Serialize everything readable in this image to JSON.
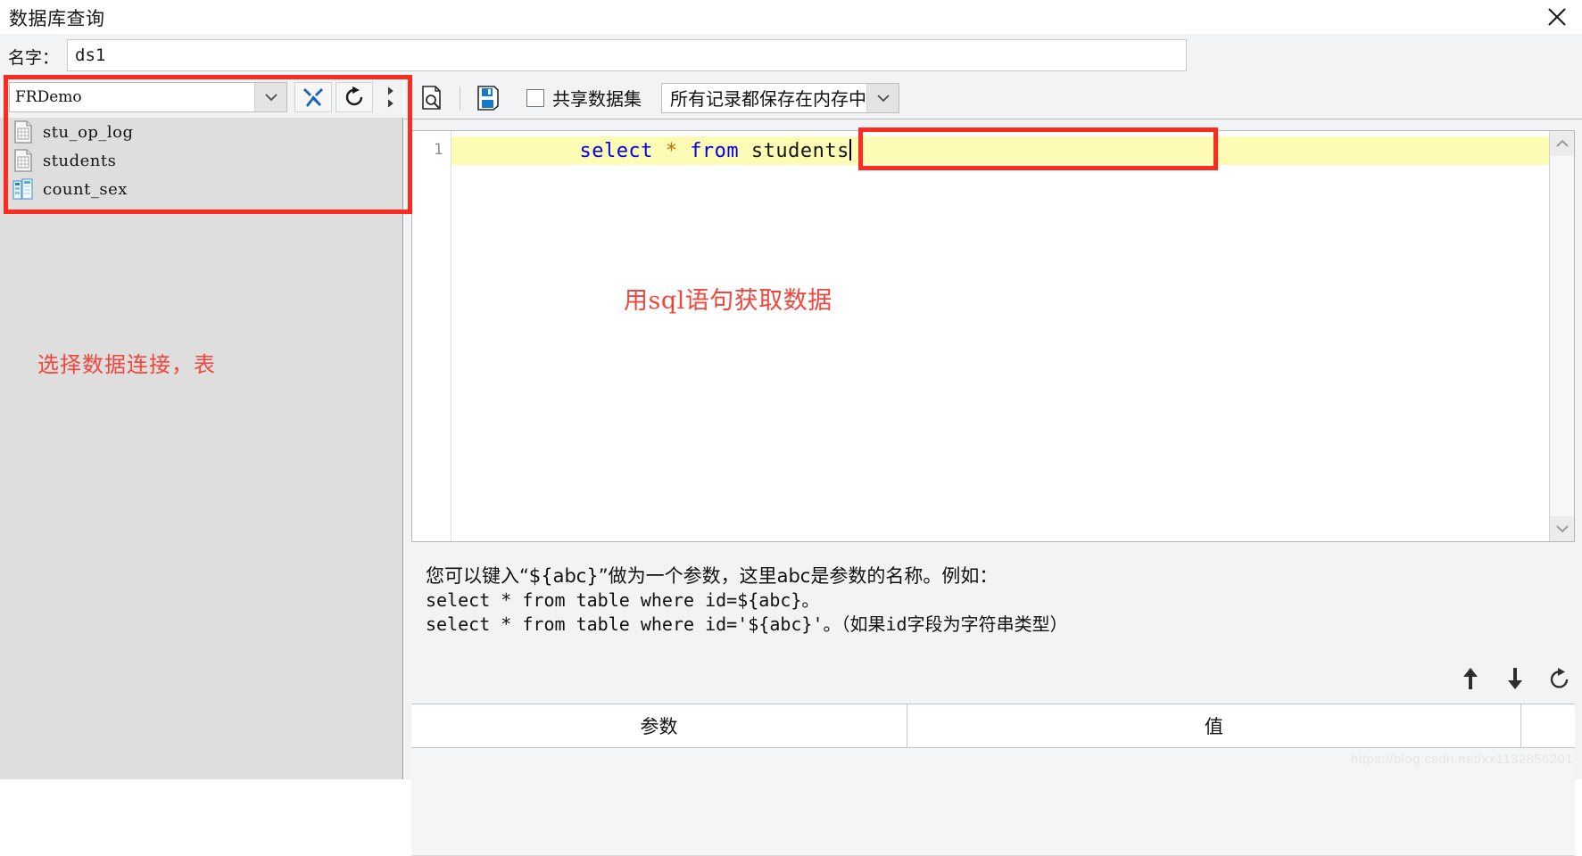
{
  "window": {
    "title": "数据库查询",
    "close_icon": "close-icon"
  },
  "name_row": {
    "label": "名字：",
    "value": "ds1",
    "placeholder": ""
  },
  "left_panel": {
    "connection": {
      "value": "FRDemo",
      "dropdown_icon": "chevron-down-icon"
    },
    "buttons": [
      {
        "name": "edit-connection-button",
        "icon": "wrench-icon"
      },
      {
        "name": "refresh-connection-button",
        "icon": "refresh-icon"
      },
      {
        "name": "toolbar-overflow-button",
        "icon": "overflow-chevron-icon"
      }
    ],
    "tree_items": [
      {
        "label": "stu_op_log",
        "icon": "table-icon"
      },
      {
        "label": "students",
        "icon": "table-icon"
      },
      {
        "label": "count_sex",
        "icon": "view-icon"
      }
    ],
    "annotation": "选择数据连接，表"
  },
  "sql_toolbar": {
    "preview_icon": "preview-document-icon",
    "save_icon": "save-icon",
    "share_checkbox": {
      "label": "共享数据集",
      "checked": false
    },
    "store_select": {
      "value": "所有记录都保存在内存中",
      "dropdown_icon": "chevron-down-icon"
    }
  },
  "editor": {
    "line_number": "1",
    "sql_tokens": [
      {
        "text": "select",
        "type": "keyword"
      },
      {
        "text": " ",
        "type": "plain"
      },
      {
        "text": "*",
        "type": "star"
      },
      {
        "text": " ",
        "type": "plain"
      },
      {
        "text": "from",
        "type": "keyword"
      },
      {
        "text": " ",
        "type": "plain"
      },
      {
        "text": "students",
        "type": "ident"
      }
    ],
    "sql_text": "select * from students",
    "annotation": "用sql语句获取数据",
    "scrollbar": {
      "up_icon": "chevron-up-icon",
      "down_icon": "chevron-down-icon"
    }
  },
  "help": {
    "line1": "您可以键入“${abc}”做为一个参数，这里abc是参数的名称。例如：",
    "line2": "select * from table where id=${abc}。",
    "line3": "select * from table where id='${abc}'。（如果id字段为字符串类型）"
  },
  "param_tools": [
    {
      "name": "move-up-button",
      "icon": "arrow-up-icon"
    },
    {
      "name": "move-down-button",
      "icon": "arrow-down-icon"
    },
    {
      "name": "refresh-params-button",
      "icon": "refresh-icon"
    }
  ],
  "param_table": {
    "columns": [
      "参数",
      "值",
      ""
    ],
    "rows": []
  },
  "watermark": "https://blog.csdn.net/xx1132856201",
  "colors": {
    "annotation_red": "#f4453c",
    "highlight_box_red": "#fd2a20",
    "sql_keyword_blue": "#0000e6",
    "sql_star_orange": "#c07000",
    "code_line_yellow": "#fdfbb4",
    "panel_gray": "#dedede",
    "chrome_gray": "#f2f3f5"
  }
}
